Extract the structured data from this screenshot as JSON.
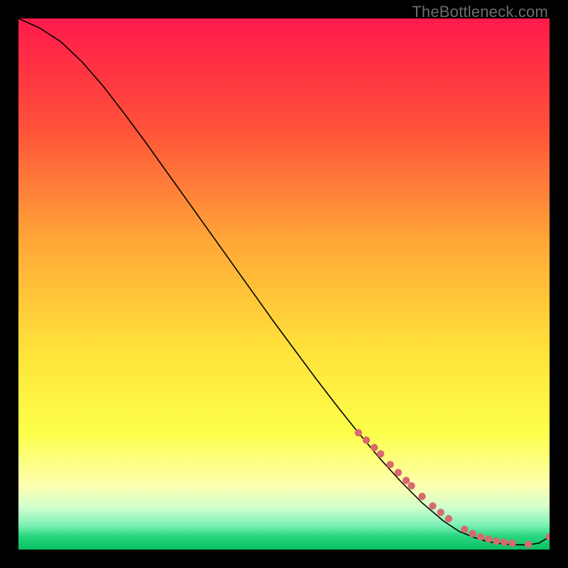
{
  "watermark": "TheBottleneck.com",
  "chart_data": {
    "type": "line",
    "title": "",
    "xlabel": "",
    "ylabel": "",
    "xlim": [
      0,
      100
    ],
    "ylim": [
      0,
      100
    ],
    "grid": false,
    "legend": false,
    "background_gradient_stops": [
      {
        "offset": 0.0,
        "color": "#ff1a4b"
      },
      {
        "offset": 0.2,
        "color": "#ff4f3a"
      },
      {
        "offset": 0.42,
        "color": "#ffa737"
      },
      {
        "offset": 0.62,
        "color": "#ffe13a"
      },
      {
        "offset": 0.78,
        "color": "#fcff4a"
      },
      {
        "offset": 0.88,
        "color": "#fdffb0"
      },
      {
        "offset": 0.92,
        "color": "#d3ffce"
      },
      {
        "offset": 0.955,
        "color": "#7af0b5"
      },
      {
        "offset": 0.975,
        "color": "#27d67e"
      },
      {
        "offset": 1.0,
        "color": "#0bbf63"
      }
    ],
    "series": [
      {
        "name": "bottleneck-curve",
        "color": "#000000",
        "x": [
          0,
          4,
          8,
          12,
          16,
          20,
          24,
          28,
          32,
          36,
          40,
          44,
          48,
          52,
          56,
          60,
          64,
          68,
          72,
          76,
          80,
          83,
          86,
          88,
          90,
          92,
          94,
          96,
          98,
          100
        ],
        "y": [
          100,
          98.2,
          95.6,
          91.8,
          87.2,
          82.0,
          76.6,
          71.0,
          65.4,
          59.8,
          54.2,
          48.6,
          43.0,
          37.6,
          32.2,
          27.0,
          22.0,
          17.2,
          12.8,
          8.8,
          5.4,
          3.4,
          2.2,
          1.6,
          1.2,
          1.0,
          0.9,
          0.9,
          1.2,
          2.4
        ]
      }
    ],
    "markers": {
      "name": "highlighted-points",
      "color": "#d86a6f",
      "radius": 5.2,
      "x": [
        64,
        65.5,
        67,
        68.2,
        70,
        71.5,
        73,
        74,
        76,
        78,
        79.5,
        81,
        84,
        85.5,
        87,
        88.5,
        90,
        91.5,
        93,
        96,
        100
      ],
      "y": [
        22.0,
        20.6,
        19.2,
        18.0,
        16.0,
        14.5,
        13.0,
        12.0,
        10.0,
        8.2,
        7.0,
        5.8,
        3.8,
        3.0,
        2.4,
        2.0,
        1.6,
        1.4,
        1.2,
        1.0,
        2.4
      ]
    }
  }
}
